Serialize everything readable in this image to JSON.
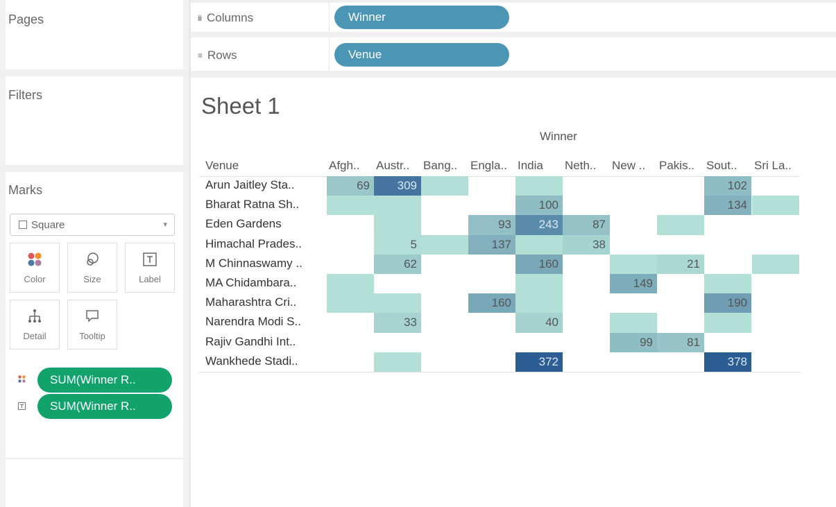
{
  "pages": {
    "title": "Pages"
  },
  "filters": {
    "title": "Filters"
  },
  "shelves": {
    "columns_label": "Columns",
    "columns_pill": "Winner",
    "rows_label": "Rows",
    "rows_pill": "Venue"
  },
  "marks": {
    "title": "Marks",
    "mark_type": "Square",
    "buttons": {
      "color": "Color",
      "size": "Size",
      "label": "Label",
      "detail": "Detail",
      "tooltip": "Tooltip"
    },
    "pills": [
      "SUM(Winner R..",
      "SUM(Winner R.."
    ]
  },
  "sheet": {
    "title": "Sheet 1",
    "column_header": "Winner",
    "row_header": "Venue"
  },
  "chart_data": {
    "type": "heatmap",
    "columns": [
      "Afgh..",
      "Austr..",
      "Bang..",
      "Engla..",
      "India",
      "Neth..",
      "New ..",
      "Pakis..",
      "Sout..",
      "Sri La.."
    ],
    "rows": [
      "Arun Jaitley Sta..",
      "Bharat Ratna Sh..",
      "Eden Gardens",
      "Himachal Prades..",
      "M Chinnaswamy ..",
      "MA Chidambara..",
      "Maharashtra Cri..",
      "Narendra Modi S..",
      "Rajiv Gandhi Int..",
      "Wankhede Stadi.."
    ],
    "cells": [
      {
        "row": 0,
        "col": 0,
        "value": 69
      },
      {
        "row": 0,
        "col": 1,
        "value": 309
      },
      {
        "row": 0,
        "col": 2,
        "value": null
      },
      {
        "row": 0,
        "col": 4,
        "value": null
      },
      {
        "row": 0,
        "col": 8,
        "value": 102
      },
      {
        "row": 1,
        "col": 0,
        "value": null
      },
      {
        "row": 1,
        "col": 1,
        "value": null
      },
      {
        "row": 1,
        "col": 4,
        "value": 100
      },
      {
        "row": 1,
        "col": 8,
        "value": 134
      },
      {
        "row": 1,
        "col": 9,
        "value": null
      },
      {
        "row": 2,
        "col": 1,
        "value": null
      },
      {
        "row": 2,
        "col": 3,
        "value": 93
      },
      {
        "row": 2,
        "col": 4,
        "value": 243
      },
      {
        "row": 2,
        "col": 5,
        "value": 87
      },
      {
        "row": 2,
        "col": 7,
        "value": null
      },
      {
        "row": 3,
        "col": 1,
        "value": 5
      },
      {
        "row": 3,
        "col": 2,
        "value": null
      },
      {
        "row": 3,
        "col": 3,
        "value": 137
      },
      {
        "row": 3,
        "col": 4,
        "value": null
      },
      {
        "row": 3,
        "col": 5,
        "value": 38
      },
      {
        "row": 4,
        "col": 1,
        "value": 62
      },
      {
        "row": 4,
        "col": 4,
        "value": 160
      },
      {
        "row": 4,
        "col": 6,
        "value": null
      },
      {
        "row": 4,
        "col": 7,
        "value": 21
      },
      {
        "row": 4,
        "col": 9,
        "value": null
      },
      {
        "row": 5,
        "col": 0,
        "value": null
      },
      {
        "row": 5,
        "col": 4,
        "value": null
      },
      {
        "row": 5,
        "col": 6,
        "value": 149
      },
      {
        "row": 5,
        "col": 8,
        "value": null
      },
      {
        "row": 6,
        "col": 0,
        "value": null
      },
      {
        "row": 6,
        "col": 1,
        "value": null
      },
      {
        "row": 6,
        "col": 3,
        "value": 160
      },
      {
        "row": 6,
        "col": 4,
        "value": null
      },
      {
        "row": 6,
        "col": 8,
        "value": 190
      },
      {
        "row": 7,
        "col": 1,
        "value": 33
      },
      {
        "row": 7,
        "col": 4,
        "value": 40
      },
      {
        "row": 7,
        "col": 6,
        "value": null
      },
      {
        "row": 7,
        "col": 8,
        "value": null
      },
      {
        "row": 8,
        "col": 6,
        "value": 99
      },
      {
        "row": 8,
        "col": 7,
        "value": 81
      },
      {
        "row": 9,
        "col": 1,
        "value": null
      },
      {
        "row": 9,
        "col": 4,
        "value": 372
      },
      {
        "row": 9,
        "col": 8,
        "value": 378
      }
    ],
    "color_range": [
      "#b3e0d6",
      "#2a5b92"
    ],
    "value_range": [
      0,
      380
    ]
  }
}
